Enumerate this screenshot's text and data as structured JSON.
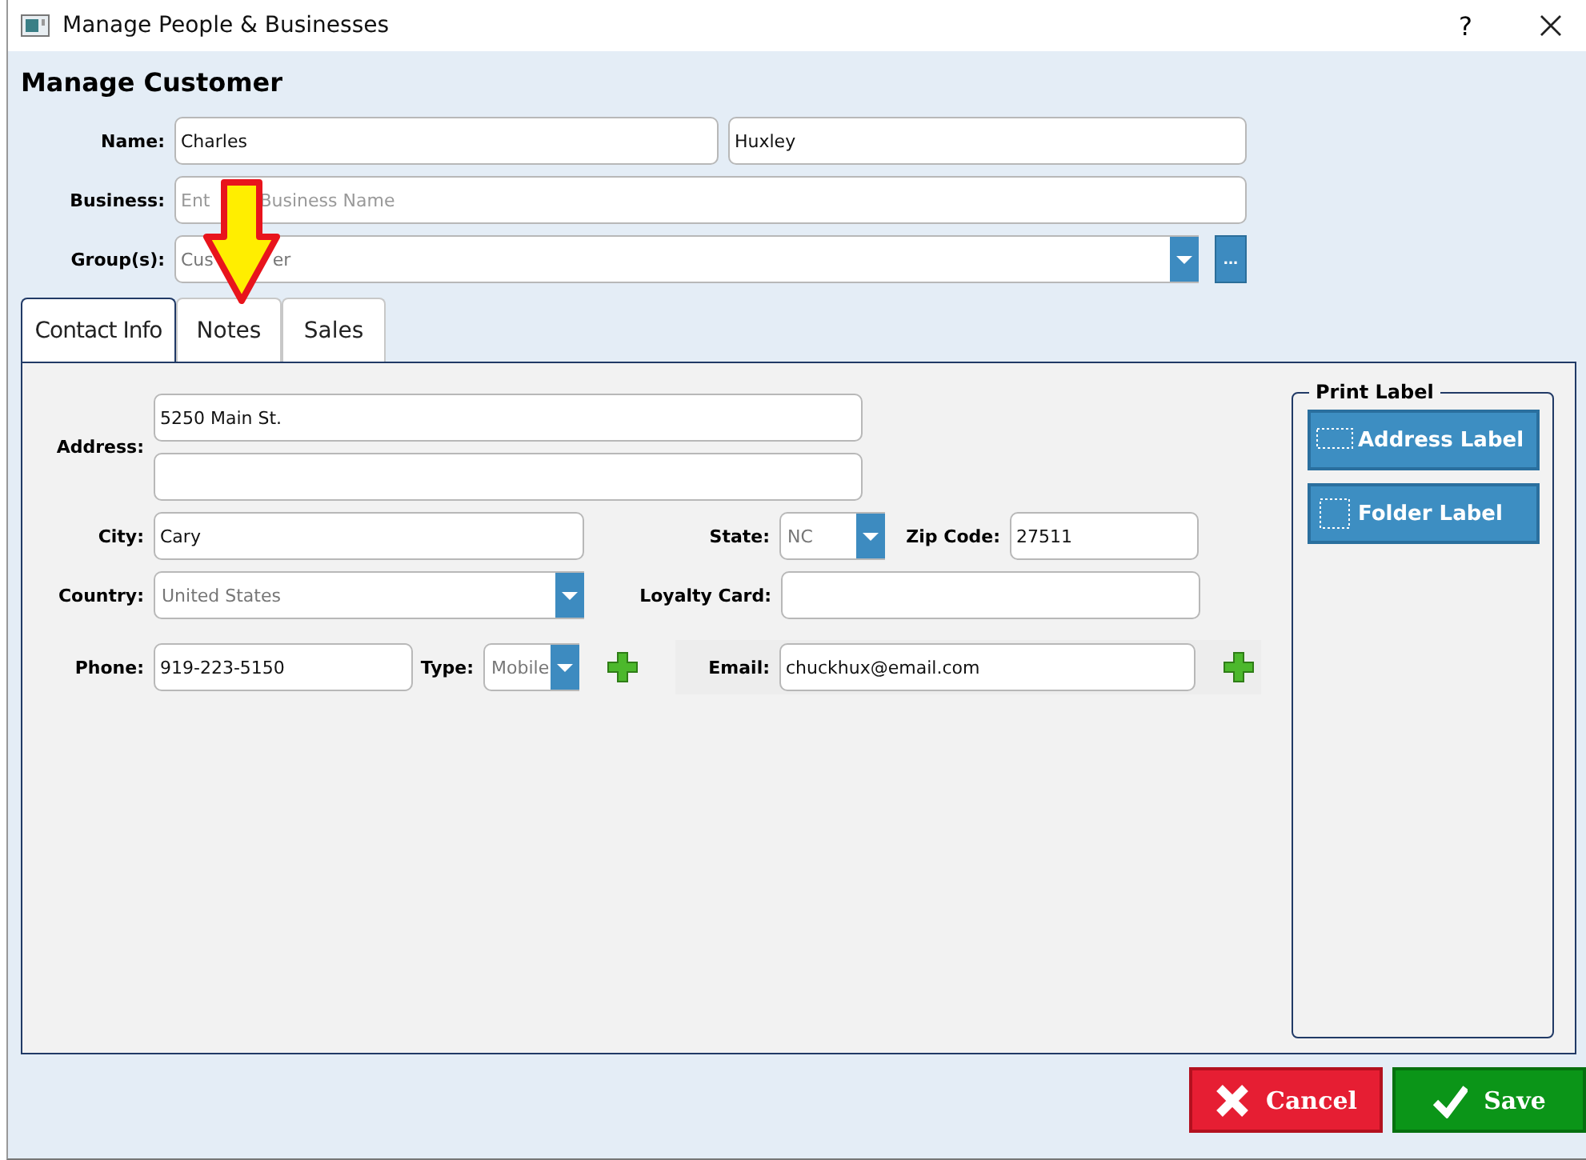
{
  "window": {
    "title": "Manage People & Businesses",
    "help": "?"
  },
  "heading": "Manage Customer",
  "name": {
    "label": "Name:",
    "first": "Charles",
    "last": "Huxley"
  },
  "business": {
    "label": "Business:",
    "placeholder_parts": [
      "Ent",
      "Business Name"
    ]
  },
  "groups": {
    "label": "Group(s):",
    "value_parts": [
      "Cus",
      "er"
    ],
    "more": "..."
  },
  "tabs": [
    {
      "label": "Contact Info",
      "selected": true
    },
    {
      "label": "Notes",
      "selected": false
    },
    {
      "label": "Sales",
      "selected": false
    }
  ],
  "contact": {
    "address": {
      "label": "Address:",
      "line1": "5250 Main St."
    },
    "city": {
      "label": "City:",
      "value": "Cary"
    },
    "state": {
      "label": "State:",
      "value": "NC"
    },
    "zip": {
      "label": "Zip Code:",
      "value": "27511"
    },
    "country": {
      "label": "Country:",
      "value": "United States"
    },
    "loyalty": {
      "label": "Loyalty Card:"
    },
    "phone": {
      "label": "Phone:",
      "value": "919-223-5150"
    },
    "phone_type": {
      "label": "Type:",
      "value": "Mobile"
    },
    "email": {
      "label": "Email:",
      "value": "chuckhux@email.com"
    }
  },
  "print_label": {
    "title": "Print Label",
    "buttons": [
      {
        "label": "Address Label",
        "kind": "address"
      },
      {
        "label": "Folder Label",
        "kind": "folder"
      }
    ]
  },
  "actions": [
    {
      "label": "Cancel",
      "kind": "cancel"
    },
    {
      "label": "Save",
      "kind": "save"
    }
  ]
}
